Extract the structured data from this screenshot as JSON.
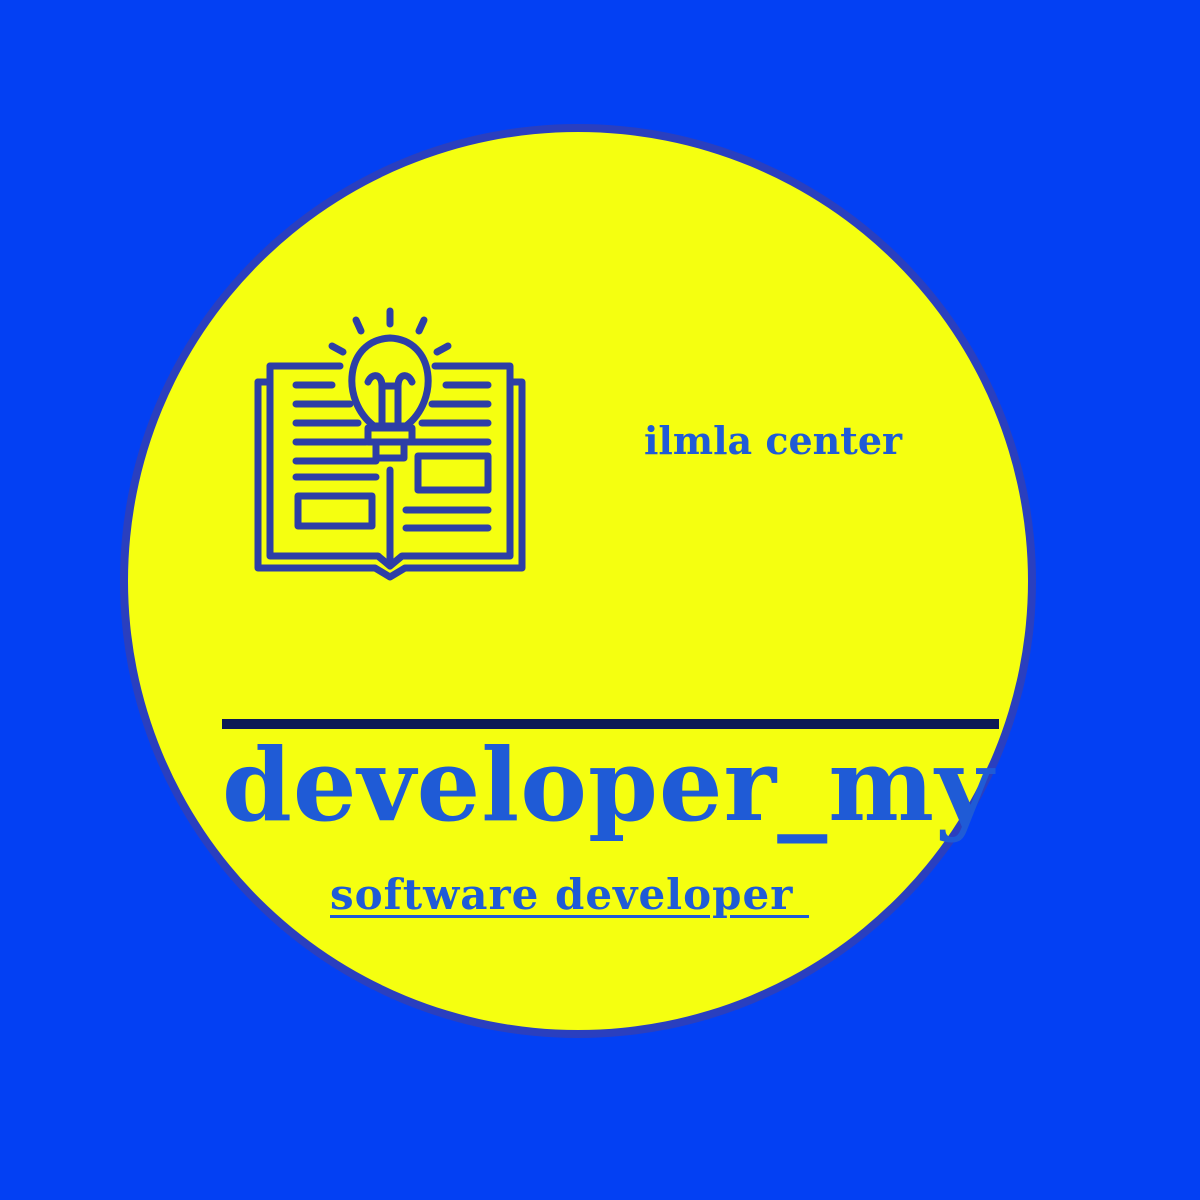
{
  "colors": {
    "background": "#0340f3",
    "disc": "#f5ff10",
    "disc_rim": "#2a3fbf",
    "text": "#1f5bd6",
    "icon_stroke": "#2d3ea6",
    "rule": "#0d1a55"
  },
  "logo": {
    "icon": "open-book-lightbulb-icon",
    "tagline": "ilmla center",
    "wordmark": "developer_my",
    "role": "software developer "
  }
}
